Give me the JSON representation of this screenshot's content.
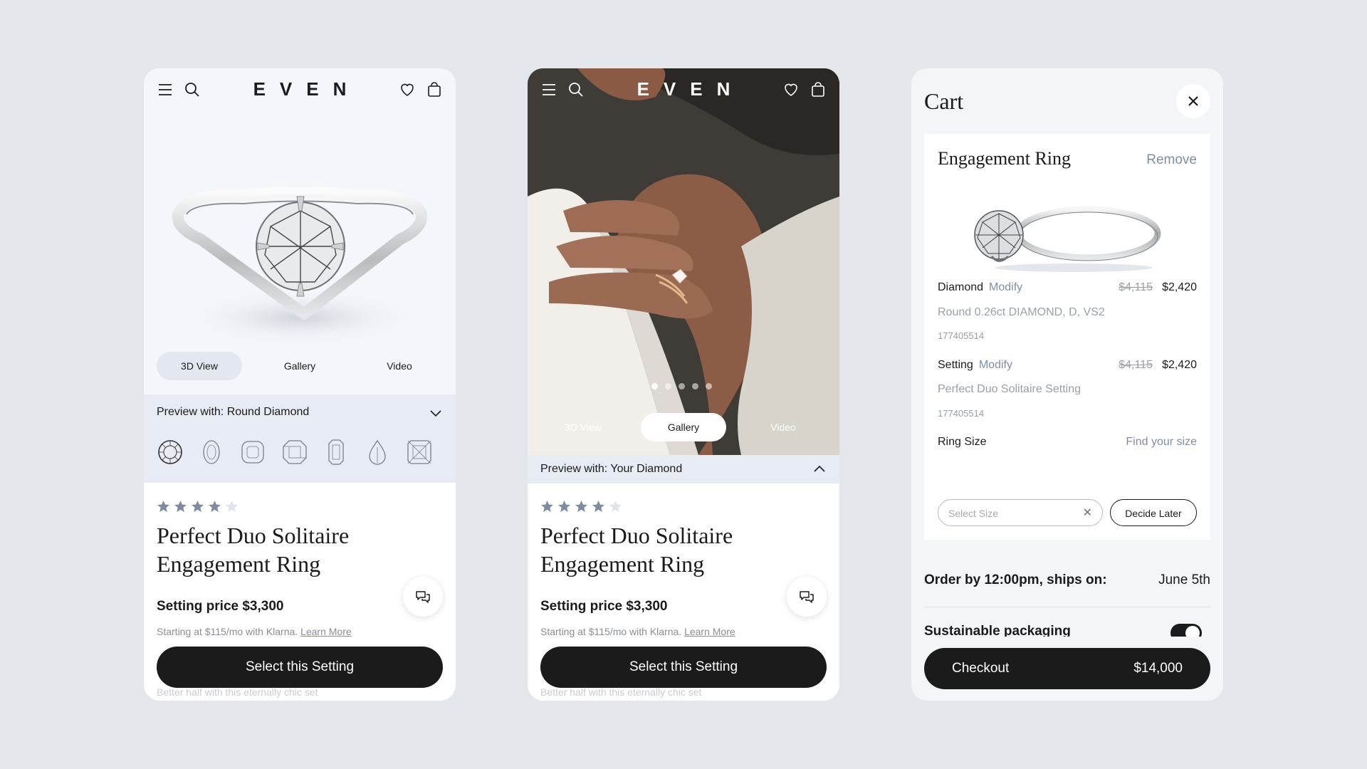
{
  "brand": "EVEN",
  "colors": {
    "background": "#e3e6eb",
    "primary": "#1b1b1b",
    "link": "#7e8ea6",
    "panel": "#e7ebf3"
  },
  "product_page_3d": {
    "tabs": [
      "3D View",
      "Gallery",
      "Video"
    ],
    "active_tab": "3D View",
    "preview_label": "Preview with: Round Diamond",
    "shape_icons": [
      "round-icon",
      "oval-icon",
      "cushion-icon",
      "asscher-icon",
      "emerald-icon",
      "pear-icon",
      "radiant-icon"
    ],
    "rating": 4,
    "rating_max": 5,
    "title_line1": "Perfect Duo Solitaire",
    "title_line2": "Engagement Ring",
    "price": "Setting price $3,300",
    "klarna_text": "Starting at $115/mo with Klarna.",
    "klarna_link": "Learn More",
    "cta": "Select this Setting",
    "fade_text": "Better half with this eternally chic set"
  },
  "product_page_gallery": {
    "tabs": [
      "3D View",
      "Gallery",
      "Video"
    ],
    "active_tab": "Gallery",
    "carousel_dots": 5,
    "active_dot": 1,
    "preview_label": "Preview with: Your Diamond",
    "rating": 4,
    "rating_max": 5,
    "title_line1": "Perfect Duo Solitaire",
    "title_line2": "Engagement Ring",
    "price": "Setting price $3,300",
    "klarna_text": "Starting at $115/mo with Klarna.",
    "klarna_link": "Learn More",
    "cta": "Select this Setting",
    "fade_text": "Better half with this eternally chic set"
  },
  "cart": {
    "title": "Cart",
    "item": {
      "title": "Engagement Ring",
      "remove": "Remove",
      "diamond_label": "Diamond",
      "diamond_modify": "Modify",
      "diamond_old_price": "$4,115",
      "diamond_price": "$2,420",
      "diamond_desc": "Round 0.26ct DIAMOND, D, VS2",
      "diamond_sku": "177405514",
      "setting_label": "Setting",
      "setting_modify": "Modify",
      "setting_old_price": "$4,115",
      "setting_price": "$2,420",
      "setting_desc": "Perfect Duo Solitaire Setting",
      "setting_sku": "177405514",
      "ring_size_label": "Ring Size",
      "find_size": "Find your size",
      "select_size_placeholder": "Select Size",
      "decide_later": "Decide Later"
    },
    "order_by": "Order by 12:00pm, ships on:",
    "ship_date": "June 5th",
    "sustainable": "Sustainable packaging",
    "sustainable_on": true,
    "checkout_label": "Checkout",
    "checkout_total": "$14,000"
  }
}
